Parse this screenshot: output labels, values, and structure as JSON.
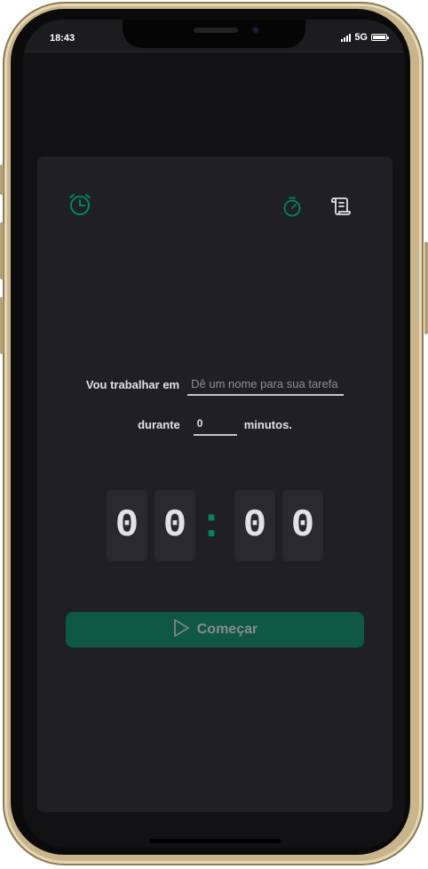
{
  "status_bar": {
    "time": "18:43",
    "network": "5G"
  },
  "header": {
    "logo_icon": "alarm-clock-icon",
    "nav": [
      {
        "name": "timer",
        "icon": "stopwatch-icon",
        "active": true
      },
      {
        "name": "history",
        "icon": "scroll-icon",
        "active": false
      }
    ]
  },
  "form": {
    "task_label": "Vou trabalhar em",
    "task_placeholder": "Dê um nome para sua tarefa",
    "task_value": "",
    "duration_label": "durante",
    "minutes_value": "0",
    "minutes_suffix": "minutos."
  },
  "countdown": {
    "minutes_tens": "0",
    "minutes_ones": "0",
    "separator": ":",
    "seconds_tens": "0",
    "seconds_ones": "0"
  },
  "start_button": {
    "label": "Começar",
    "icon": "play-icon",
    "enabled": false
  },
  "colors": {
    "accent": "#00875f",
    "background": "#121214",
    "card": "#202024",
    "digit_bg": "#29292e",
    "text": "#e1e1e6",
    "placeholder": "#8d8d99"
  }
}
